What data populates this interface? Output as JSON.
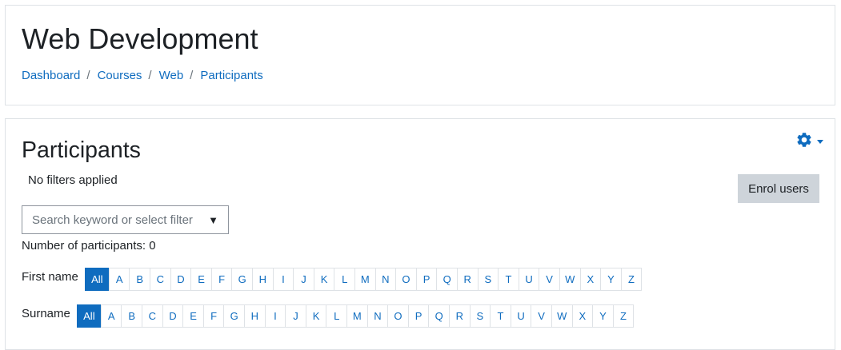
{
  "header": {
    "title": "Web Development",
    "breadcrumb": [
      {
        "label": "Dashboard"
      },
      {
        "label": "Courses"
      },
      {
        "label": "Web"
      },
      {
        "label": "Participants"
      }
    ]
  },
  "main": {
    "title": "Participants",
    "settings_icon": "gear-icon",
    "filter_status": "No filters applied",
    "enrol_button": "Enrol users",
    "search": {
      "placeholder": "Search keyword or select filter",
      "arrow": "▼"
    },
    "participant_count": "Number of participants: 0",
    "firstname": {
      "label": "First name",
      "letters": [
        "All",
        "A",
        "B",
        "C",
        "D",
        "E",
        "F",
        "G",
        "H",
        "I",
        "J",
        "K",
        "L",
        "M",
        "N",
        "O",
        "P",
        "Q",
        "R",
        "S",
        "T",
        "U",
        "V",
        "W",
        "X",
        "Y",
        "Z"
      ],
      "selected": "All"
    },
    "surname": {
      "label": "Surname",
      "letters": [
        "All",
        "A",
        "B",
        "C",
        "D",
        "E",
        "F",
        "G",
        "H",
        "I",
        "J",
        "K",
        "L",
        "M",
        "N",
        "O",
        "P",
        "Q",
        "R",
        "S",
        "T",
        "U",
        "V",
        "W",
        "X",
        "Y",
        "Z"
      ],
      "selected": "All"
    }
  },
  "colors": {
    "link": "#0f6cbf",
    "button_secondary": "#ced4da",
    "border": "#dee2e6"
  }
}
